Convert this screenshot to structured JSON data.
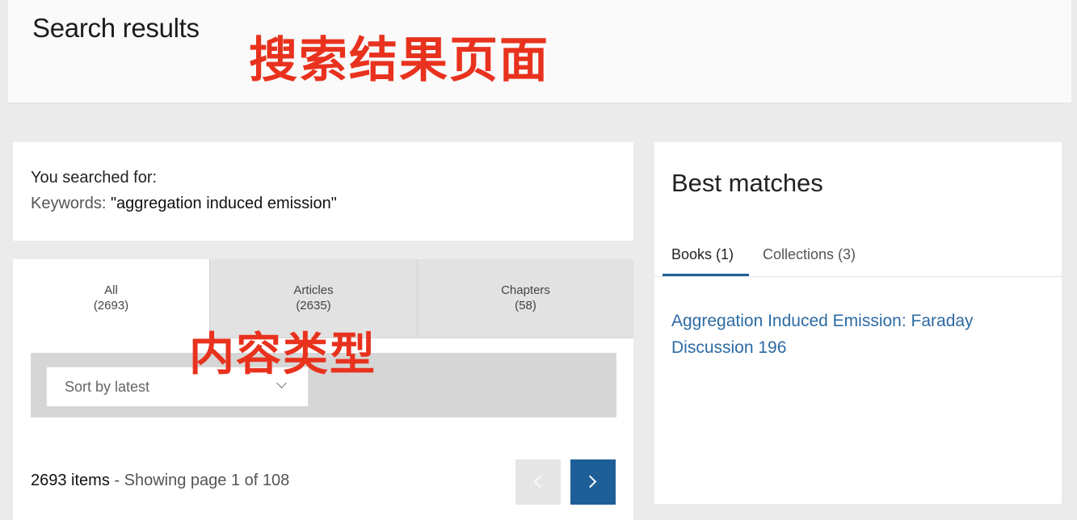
{
  "header": {
    "title": "Search results",
    "annotation": "搜索结果页面"
  },
  "search_summary": {
    "label": "You searched for:",
    "keywords_label": "Keywords:",
    "keywords_value": "\"aggregation induced emission\""
  },
  "content_tabs": {
    "annotation": "内容类型",
    "items": [
      {
        "label": "All",
        "count": "(2693)",
        "active": true
      },
      {
        "label": "Articles",
        "count": "(2635)",
        "active": false
      },
      {
        "label": "Chapters",
        "count": "(58)",
        "active": false
      }
    ]
  },
  "sort": {
    "selected": "Sort by latest"
  },
  "pagination": {
    "items_count": "2693 items",
    "separator": " - ",
    "page_text": "Showing page 1 of 108",
    "prev_icon": "chevron-left-icon",
    "next_icon": "chevron-right-icon",
    "prev_enabled": false,
    "next_color": "#1f5f98"
  },
  "best_matches": {
    "title": "Best matches",
    "tabs": [
      {
        "label": "Books (1)",
        "active": true
      },
      {
        "label": "Collections (3)",
        "active": false
      }
    ],
    "result_link": "Aggregation Induced Emission: Faraday Discussion 196",
    "accent_color": "#1f5f98",
    "link_color": "#2c6aa3"
  },
  "annotation_color": "#e8321e"
}
